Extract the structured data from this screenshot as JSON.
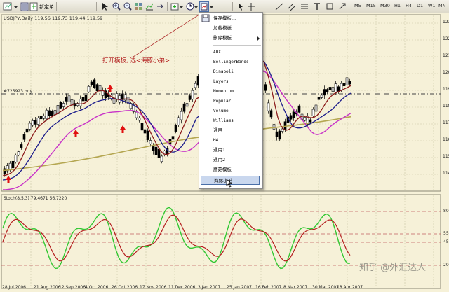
{
  "toolbar": {
    "new_order_label": "新定单",
    "timeframes": [
      "M5",
      "M15",
      "M30",
      "H1",
      "H4",
      "D1",
      "W1",
      "MN"
    ]
  },
  "chart": {
    "main_title": "USDJPY,Daily  119.56 119.73 119.44 119.59",
    "order_line_label": "#725923 buy",
    "annotation": "打开模板, 选<海豚小弟>",
    "osc_title": "Stoch(8,5,3) 79.4671 56.7220",
    "price_labels": [
      "123",
      "122",
      "121",
      "120",
      "119",
      "118",
      "117",
      "116",
      "115",
      "114"
    ],
    "osc_labels": [
      "80",
      "55",
      "45",
      "20"
    ],
    "dates": [
      "28 Jul 2006",
      "21 Aug 2006",
      "12 Sep 2006",
      "4 Oct 2006",
      "26 Oct 2006",
      "17 Nov 2006",
      "11 Dec 2006",
      "3 Jan 2007",
      "25 Jan 2007",
      "16 Feb 2007",
      "8 Mar 2007",
      "30 Mar 2007",
      "18 Apr 2007"
    ],
    "watermark": "知乎 @外汇达人"
  },
  "colors": {
    "chart_bg": "#f6f1d8",
    "ma_red": "#8b1a1a",
    "ma_blue": "#1a1a8b",
    "ma_magenta": "#c832c8",
    "ma_olive": "#b4a650",
    "stoch_main": "#32c832",
    "stoch_signal": "#b41e1e",
    "arrow": "#e01010"
  },
  "template_menu": {
    "items": [
      "保存模板...",
      "加载模板...",
      "删除模板",
      "ADX",
      "BollingerBands",
      "Dinapoli",
      "Layers",
      "Momentum",
      "Popular",
      "Volume",
      "Williams",
      "通用",
      "H4",
      "通用1",
      "通用2",
      "蘑菇模板",
      "海豚小弟"
    ],
    "selected": "海豚小弟"
  }
}
